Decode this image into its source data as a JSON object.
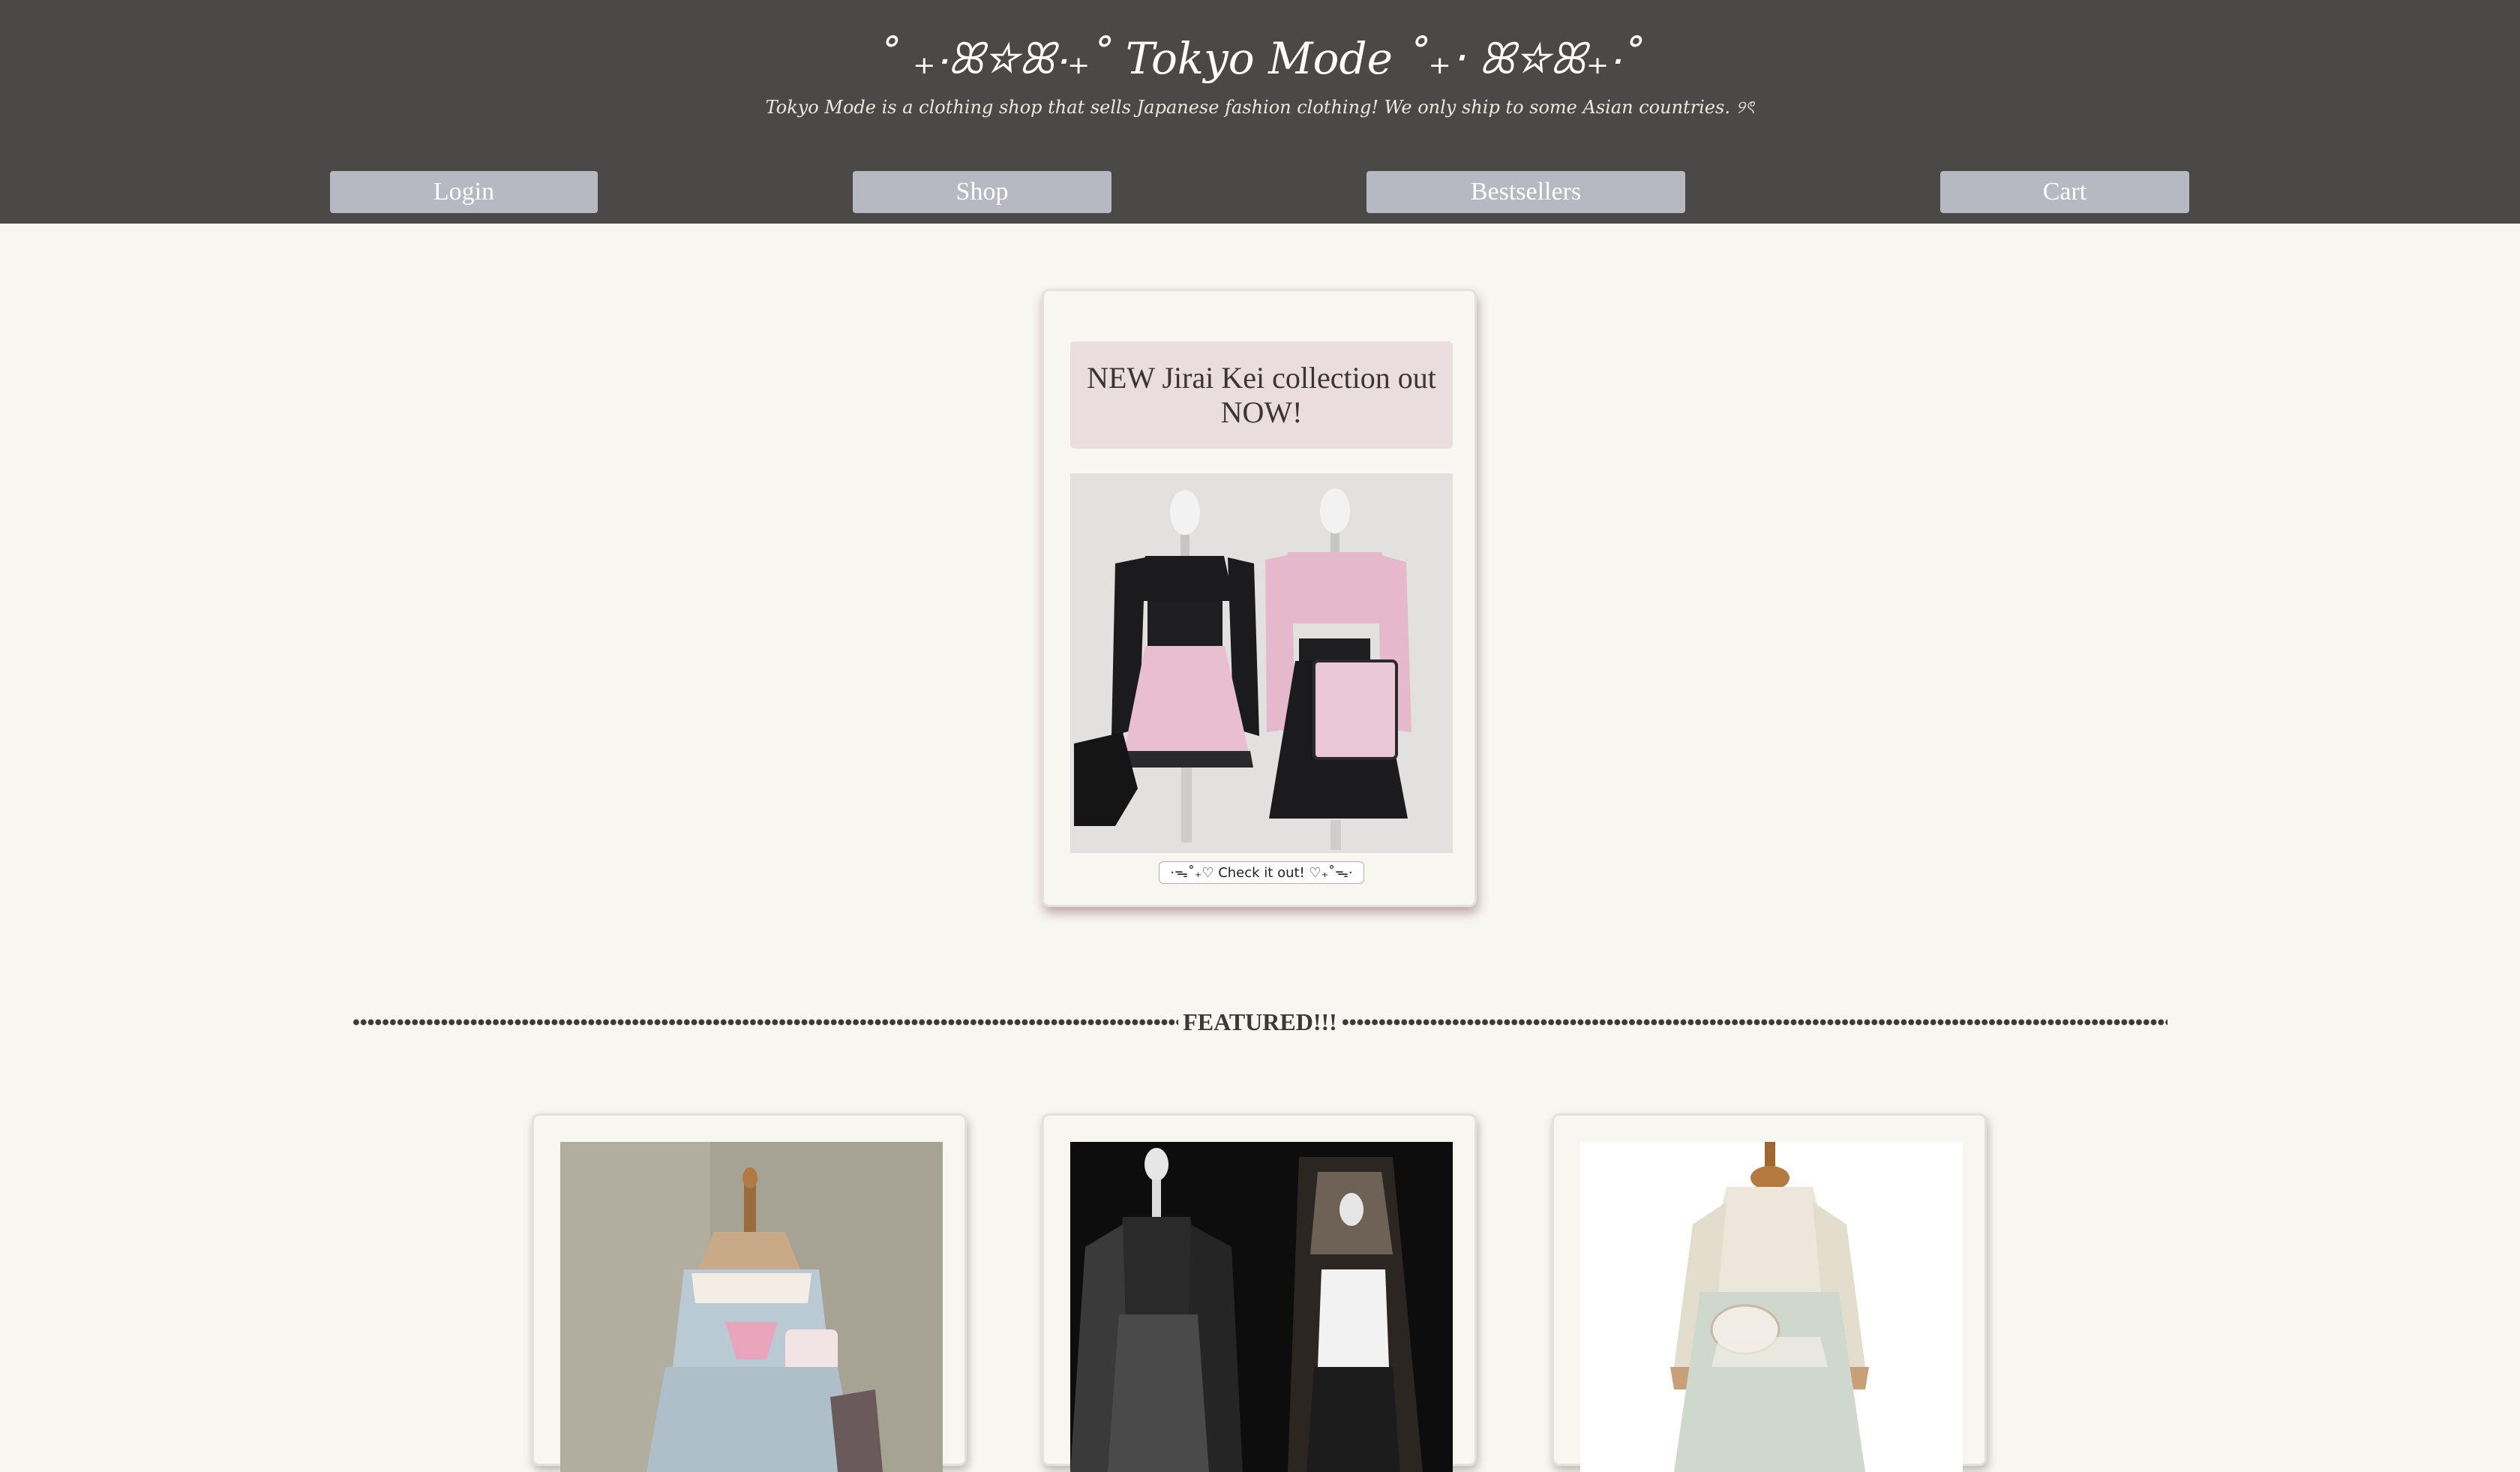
{
  "header": {
    "title": "˚ ₊‧ꕤ☆ꕤ‧₊˚ Tokyo Mode ˚₊‧ ꕤ☆ꕤ₊‧˚",
    "tagline": "Tokyo Mode is a clothing shop that sells Japanese fashion clothing! We only ship to some Asian countries. ୨ৎ",
    "background_color": "#4a4947"
  },
  "nav": {
    "login_label": "Login",
    "shop_label": "Shop",
    "bestsellers_label": "Bestsellers",
    "cart_label": "Cart",
    "button_color": "#b6b9c2"
  },
  "promo": {
    "heading": "NEW Jirai Kei collection out NOW!",
    "image_icon": "outfit-photo-icon",
    "button_label": "·ᯓ˚₊♡ Check it out! ♡₊˚ᯓ·"
  },
  "featured": {
    "label": "FEATURED!!!"
  },
  "products": [
    {
      "image_icon": "pastel-dress-photo-icon"
    },
    {
      "image_icon": "gothic-outfit-photo-icon"
    },
    {
      "image_icon": "cream-dress-photo-icon"
    }
  ],
  "colors": {
    "page_background": "#f8f6f0",
    "promo_heading_background": "#eadddf",
    "accent_pink": "#e8a6bd"
  }
}
